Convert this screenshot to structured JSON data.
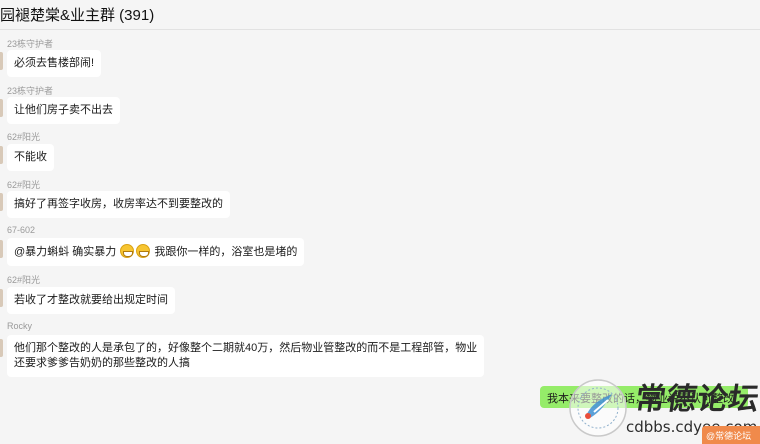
{
  "header": {
    "title": "园褪楚棠&业主群 (391)"
  },
  "messages": [
    {
      "sender": "23栋守护者",
      "text": "必须去售楼部闹!"
    },
    {
      "sender": "23栋守护者",
      "text": "让他们房子卖不出去"
    },
    {
      "sender": "62#阳光",
      "text": "不能收"
    },
    {
      "sender": "62#阳光",
      "text": "搞好了再签字收房，收房率达不到要整改的"
    },
    {
      "sender": "67-602",
      "text_a": "@暴力蝌蚪 确实暴力",
      "text_b": "我跟你一样的，浴室也是堵的"
    },
    {
      "sender": "62#阳光",
      "text": "若收了才整改就要给出规定时间"
    },
    {
      "sender": "Rocky",
      "line1": "他们那个整改的人是承包了的，好像整个二期就40万，然后物业管整改的而不是工程部管，物业",
      "line2": "还要求爹爹告奶奶的那些整改的人搞"
    }
  ],
  "self_message": {
    "text": "我本来要整改的话，物业说不认可整改"
  },
  "watermark": {
    "title": "常德论坛",
    "url": "cdbbs.cdyee.com"
  },
  "corner_chip": {
    "text": "@常德论坛"
  },
  "colors": {
    "self_bubble": "#95ec69",
    "background": "#f5f5f5",
    "bubble": "#ffffff"
  }
}
